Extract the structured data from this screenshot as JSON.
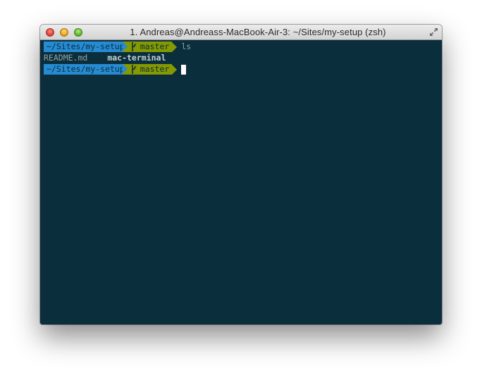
{
  "window": {
    "title": "1. Andreas@Andreass-MacBook-Air-3: ~/Sites/my-setup (zsh)"
  },
  "colors": {
    "terminal_bg": "#0b2e3d",
    "prompt_dir_bg": "#268bd2",
    "prompt_git_bg": "#859900",
    "text": "#93a1a1"
  },
  "terminal": {
    "line1": {
      "dir": "~/Sites/my-setup",
      "branch": "master",
      "command": "ls"
    },
    "line2": {
      "files": [
        "README.md",
        "mac-terminal"
      ]
    },
    "line3": {
      "dir": "~/Sites/my-setup",
      "branch": "master",
      "command": ""
    }
  },
  "icons": {
    "branch": "git-branch-icon",
    "fullscreen": "fullscreen-arrows-icon"
  }
}
